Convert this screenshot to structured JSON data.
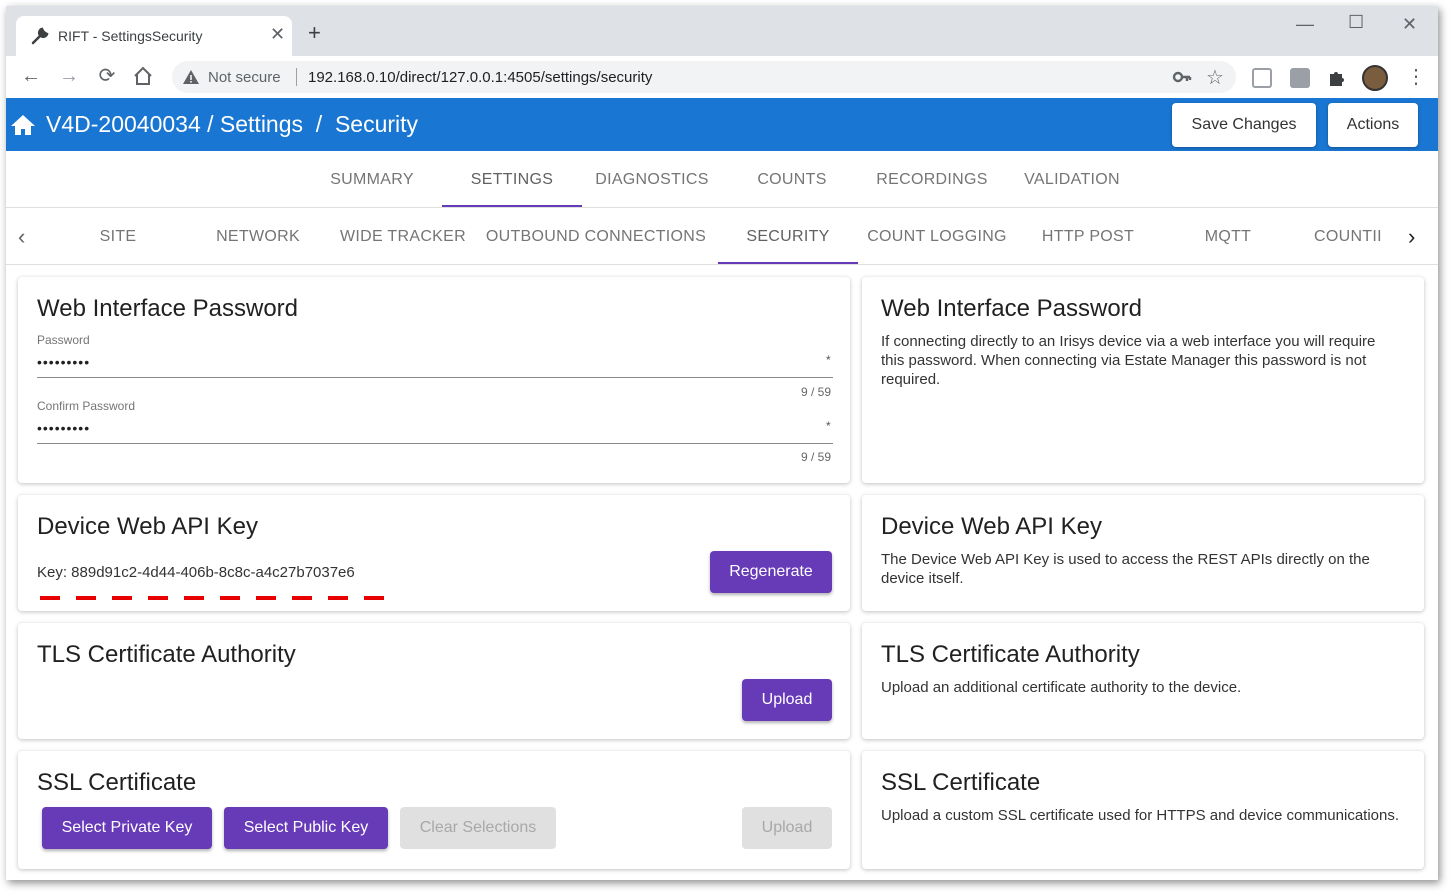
{
  "browser": {
    "tab_title": "RIFT - SettingsSecurity",
    "not_secure": "Not secure",
    "url": "192.168.0.10/direct/127.0.0.1:4505/settings/security"
  },
  "header": {
    "breadcrumb": "V4D-20040034 / Settings  /  Security",
    "save_changes": "Save Changes",
    "actions": "Actions",
    "bar_color": "#1976d2"
  },
  "main_tabs": [
    "SUMMARY",
    "SETTINGS",
    "DIAGNOSTICS",
    "COUNTS",
    "RECORDINGS",
    "VALIDATION"
  ],
  "main_tab_active": "SETTINGS",
  "sub_tabs": [
    "SITE",
    "NETWORK",
    "WIDE TRACKER",
    "OUTBOUND CONNECTIONS",
    "SECURITY",
    "COUNT LOGGING",
    "HTTP POST",
    "MQTT",
    "COUNTII"
  ],
  "sub_tab_active": "SECURITY",
  "password_card": {
    "title": "Web Interface Password",
    "password_label": "Password",
    "password_value": "•••••••••",
    "password_required": "*",
    "password_count": "9 / 59",
    "confirm_label": "Confirm Password",
    "confirm_value": "•••••••••",
    "confirm_required": "*",
    "confirm_count": "9 / 59"
  },
  "api_card": {
    "title": "Device Web API Key",
    "key_text": "Key: 889d91c2-4d44-406b-8c8c-a4c27b7037e6",
    "regenerate": "Regenerate"
  },
  "tls_card": {
    "title": "TLS Certificate Authority",
    "upload": "Upload"
  },
  "ssl_card": {
    "title": "SSL Certificate",
    "select_private": "Select Private Key",
    "select_public": "Select Public Key",
    "clear": "Clear Selections",
    "upload": "Upload"
  },
  "help": {
    "password_title": "Web Interface Password",
    "password_desc": "If connecting directly to an Irisys device via a web interface you will require this password. When connecting via Estate Manager this password is not required.",
    "api_title": "Device Web API Key",
    "api_desc": "The Device Web API Key is used to access the REST APIs directly on the device itself.",
    "tls_title": "TLS Certificate Authority",
    "tls_desc": "Upload an additional certificate authority to the device.",
    "ssl_title": "SSL Certificate",
    "ssl_desc": "Upload a custom SSL certificate used for HTTPS and device communications."
  },
  "colors": {
    "accent": "#673ab7",
    "annotation": "#e60000"
  }
}
